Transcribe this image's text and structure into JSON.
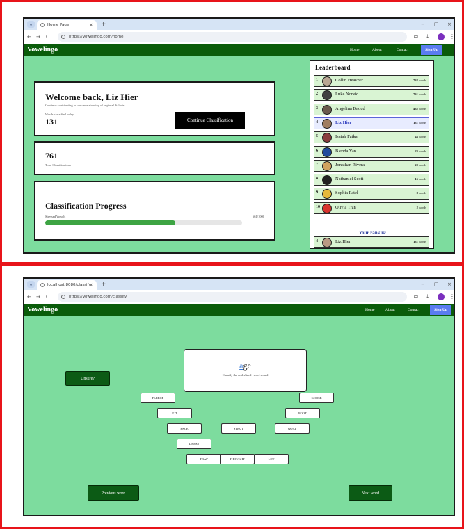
{
  "home": {
    "tab": {
      "title": "Home Page",
      "close": "×",
      "new": "+"
    },
    "window": {
      "min": "−",
      "max": "□",
      "close": "×"
    },
    "nav_controls": {
      "back": "←",
      "forward": "→",
      "reload": "C"
    },
    "url": "https://Vowelingo.com/home",
    "toolbar": {
      "copy": "⧉",
      "download": "⤓",
      "menu": "⋮"
    },
    "app": {
      "brand": "Vowelingo",
      "nav": [
        "Home",
        "About",
        "Contact"
      ],
      "signup": "Sign Up"
    },
    "welcome": {
      "title": "Welcome back, Liz Hier",
      "subtitle": "Continue contributing to our understanding of regional dialects",
      "label": "Words classified today",
      "count": "131",
      "button": "Continue Classification"
    },
    "total": {
      "count": "761",
      "label": "Total Classifications"
    },
    "progress": {
      "title": "Classification Progress",
      "label": "Stressed Vowels",
      "value_text": "661/1000",
      "fraction": 0.661
    },
    "leaderboard": {
      "title": "Leaderboard",
      "rows": [
        {
          "rank": "1",
          "name": "Collin Heavner",
          "words": "762",
          "unit": "words"
        },
        {
          "rank": "2",
          "name": "Luke Norvid",
          "words": "761",
          "unit": "words"
        },
        {
          "rank": "3",
          "name": "Angelina Daoud",
          "words": "432",
          "unit": "words"
        },
        {
          "rank": "4",
          "name": "Liz Hier",
          "words": "131",
          "unit": "words"
        },
        {
          "rank": "5",
          "name": "Isaiah Fatka",
          "words": "43",
          "unit": "words"
        },
        {
          "rank": "6",
          "name": "Blenda Yan",
          "words": "23",
          "unit": "words"
        },
        {
          "rank": "7",
          "name": "Jonathan Rivera",
          "words": "20",
          "unit": "words"
        },
        {
          "rank": "8",
          "name": "Nathaniel Scott",
          "words": "15",
          "unit": "words"
        },
        {
          "rank": "9",
          "name": "Sophia Patel",
          "words": "8",
          "unit": "words"
        },
        {
          "rank": "10",
          "name": "Olivia Tran",
          "words": "2",
          "unit": "words"
        }
      ],
      "your_rank_label": "Your rank is:",
      "your_rank": {
        "rank": "4",
        "name": "Liz Hier",
        "words": "131",
        "unit": "words"
      }
    }
  },
  "classify": {
    "tab": {
      "title": "localhost:8080/classify",
      "close": "×",
      "new": "+"
    },
    "window": {
      "min": "−",
      "max": "□",
      "close": "×"
    },
    "nav_controls": {
      "back": "←",
      "forward": "→",
      "reload": "C"
    },
    "url": "https://Vowelingo.com/classify",
    "toolbar": {
      "copy": "⧉",
      "download": "⤓",
      "menu": "⋮"
    },
    "app": {
      "brand": "Vowelingo",
      "nav": [
        "Home",
        "About",
        "Contact"
      ],
      "signup": "Sign Up"
    },
    "word": {
      "highlight": "a",
      "rest": "ge",
      "instruction": "Classify the underlined vowel sound"
    },
    "unsure": "Unsure?",
    "prev": "Previous word",
    "next": "Next word",
    "vowels": [
      "FLEECE",
      "GOOSE",
      "KIT",
      "FOOT",
      "FACE",
      "STRUT",
      "GOAT",
      "DRESS",
      "TRAP",
      "THOUGHT",
      "LOT"
    ]
  }
}
